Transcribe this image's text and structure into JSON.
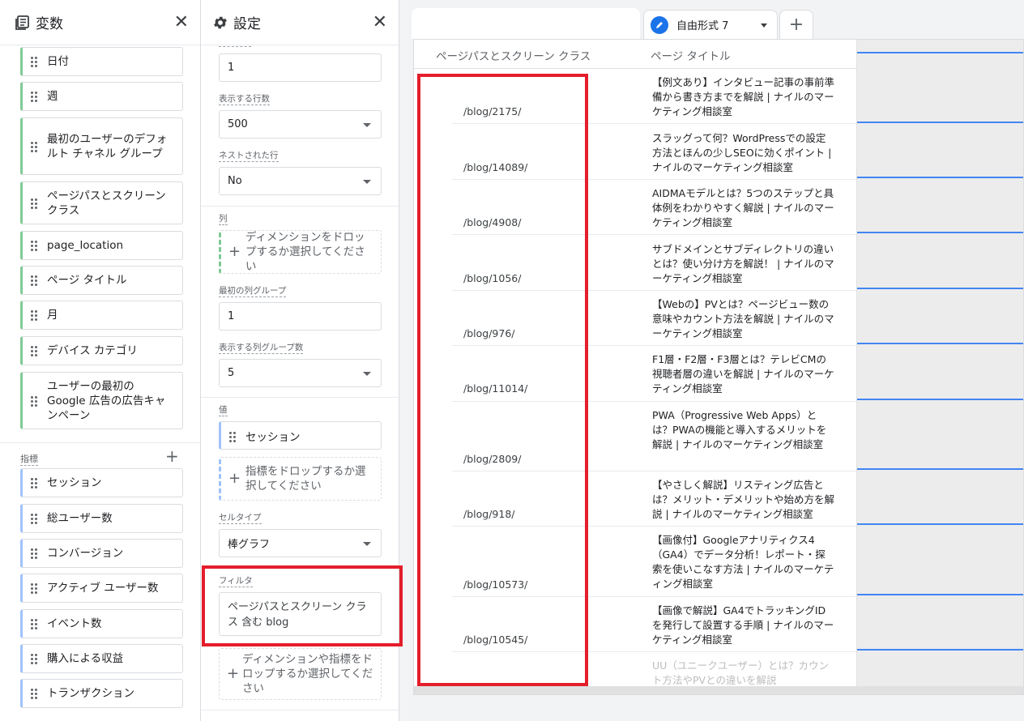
{
  "variables_panel": {
    "title": "変数",
    "dimensions": [
      "日付",
      "週",
      "最初のユーザーのデフォルト チャネル グループ",
      "ページパスとスクリーン クラス",
      "page_location",
      "ページ タイトル",
      "月",
      "デバイス カテゴリ",
      "ユーザーの最初の Google 広告の広告キャンペーン"
    ],
    "metrics_label": "指標",
    "metrics": [
      "セッション",
      "総ユーザー数",
      "コンバージョン",
      "アクティブ ユーザー数",
      "イベント数",
      "購入による収益",
      "トランザクション"
    ]
  },
  "settings_panel": {
    "title": "設定",
    "top_value": "1",
    "rows_shown_label": "表示する行数",
    "rows_shown_value": "500",
    "nested_rows_label": "ネストされた行",
    "nested_rows_value": "No",
    "columns_label": "列",
    "columns_drop": "ディメンションをドロップするか選択してください",
    "first_col_group_label": "最初の列グループ",
    "first_col_group_value": "1",
    "col_groups_shown_label": "表示する列グループ数",
    "col_groups_shown_value": "5",
    "values_label": "値",
    "values_chip": "セッション",
    "values_drop": "指標をドロップするか選択してください",
    "cell_type_label": "セルタイプ",
    "cell_type_value": "棒グラフ",
    "filter_label": "フィルタ",
    "filter_value": "ページパスとスクリーン クラス 含む blog",
    "filter_drop": "ディメンションや指標をドロップするか選択してください"
  },
  "tabs": {
    "active_label": "自由形式 7"
  },
  "table": {
    "col1_header": "ページパスとスクリーン クラス",
    "col2_header": "ページ タイトル",
    "rows": [
      {
        "path": "/blog/2175/",
        "title": "【例文あり】インタビュー記事の事前準備から書き方までを解説 | ナイルのマーケティング相談室"
      },
      {
        "path": "/blog/14089/",
        "title": "スラッグって何？WordPressでの設定方法とほんの少しSEOに効くポイント | ナイルのマーケティング相談室"
      },
      {
        "path": "/blog/4908/",
        "title": "AIDMAモデルとは？5つのステップと具体例をわかりやすく解説 | ナイルのマーケティング相談室"
      },
      {
        "path": "/blog/1056/",
        "title": "サブドメインとサブディレクトリの違いとは？使い分け方を解説！ | ナイルのマーケティング相談室"
      },
      {
        "path": "/blog/976/",
        "title": "【Webの】PVとは？ページビュー数の意味やカウント方法を解説 | ナイルのマーケティング相談室"
      },
      {
        "path": "/blog/11014/",
        "title": "F1層・F2層・F3層とは？テレビCMの視聴者層の違いを解説 | ナイルのマーケティング相談室"
      },
      {
        "path": "/blog/2809/",
        "title": "PWA（Progressive Web Apps）とは？PWAの機能と導入するメリットを解説 | ナイルのマーケティング相談室"
      },
      {
        "path": "/blog/918/",
        "title": "【やさしく解説】リスティング広告とは？メリット・デメリットや始め方を解説 | ナイルのマーケティング相談室"
      },
      {
        "path": "/blog/10573/",
        "title": "【画像付】Googleアナリティクス4（GA4）でデータ分析！レポート・探索を使いこなす方法 | ナイルのマーケティング相談室"
      },
      {
        "path": "/blog/10545/",
        "title": "【画像で解説】GA4でトラッキングIDを発行して設置する手順 | ナイルのマーケティング相談室"
      },
      {
        "path": "",
        "title": "UU（ユニークユーザー）とは？カウント方法やPVとの違いを解説"
      }
    ]
  }
}
